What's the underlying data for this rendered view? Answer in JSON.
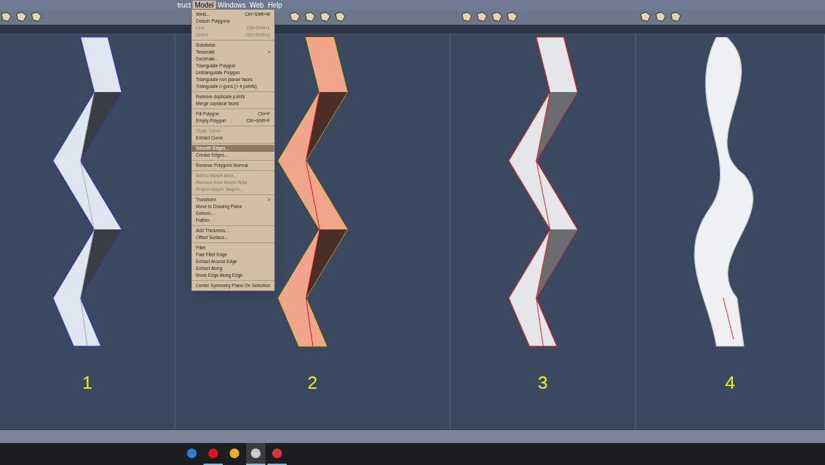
{
  "menubar": [
    {
      "label": "truct",
      "selected": false
    },
    {
      "label": "Model",
      "selected": true
    },
    {
      "label": "Windows",
      "selected": false
    },
    {
      "label": "Web",
      "selected": false
    },
    {
      "label": "Help",
      "selected": false
    }
  ],
  "menu": [
    {
      "kind": "item",
      "label": "Weld...",
      "shortcut": "Ctrl+Shift+W",
      "disabled": false,
      "selected": false
    },
    {
      "kind": "item",
      "label": "Detach Polygons",
      "disabled": false,
      "selected": false
    },
    {
      "kind": "item",
      "label": "Link",
      "shortcut": "Ctrl+Shift+L",
      "disabled": true,
      "selected": false
    },
    {
      "kind": "item",
      "label": "Unlink",
      "shortcut": "Ctrl+Shift+U",
      "disabled": true,
      "selected": false
    },
    {
      "kind": "separator"
    },
    {
      "kind": "item",
      "label": "Subdivide",
      "disabled": false,
      "selected": false
    },
    {
      "kind": "submenu",
      "label": "Tesselate",
      "arrow": ">",
      "disabled": false,
      "selected": false
    },
    {
      "kind": "item",
      "label": "Decimate...",
      "disabled": false,
      "selected": false
    },
    {
      "kind": "item",
      "label": "Triangulate Polygon",
      "disabled": false,
      "selected": false
    },
    {
      "kind": "item",
      "label": "Untriangulate Polygon",
      "disabled": false,
      "selected": false
    },
    {
      "kind": "item",
      "label": "Triangulate non planar faces",
      "disabled": false,
      "selected": false
    },
    {
      "kind": "item",
      "label": "Triangulate n-gons (> 4 points)",
      "disabled": false,
      "selected": false
    },
    {
      "kind": "separator"
    },
    {
      "kind": "item",
      "label": "Remove duplicate points",
      "disabled": false,
      "selected": false
    },
    {
      "kind": "item",
      "label": "Merge coplanar faces",
      "disabled": false,
      "selected": false
    },
    {
      "kind": "separator"
    },
    {
      "kind": "item",
      "label": "Fill Polygon",
      "shortcut": "Ctrl+F",
      "disabled": false,
      "selected": false
    },
    {
      "kind": "item",
      "label": "Empty Polygon",
      "shortcut": "Ctrl+Shift+F",
      "disabled": false,
      "selected": false
    },
    {
      "kind": "separator"
    },
    {
      "kind": "item",
      "label": "Close Curve",
      "disabled": true,
      "selected": false
    },
    {
      "kind": "item",
      "label": "Extract Curve",
      "disabled": false,
      "selected": false
    },
    {
      "kind": "separator"
    },
    {
      "kind": "item",
      "label": "Smooth Edges...",
      "disabled": false,
      "selected": true
    },
    {
      "kind": "item",
      "label": "Crease Edges...",
      "disabled": false,
      "selected": false
    },
    {
      "kind": "separator"
    },
    {
      "kind": "item",
      "label": "Reverse Polygons Normal",
      "disabled": false,
      "selected": false
    },
    {
      "kind": "separator"
    },
    {
      "kind": "item",
      "label": "Add to Morph Area...",
      "disabled": true,
      "selected": false
    },
    {
      "kind": "item",
      "label": "Remove from Morph Area",
      "disabled": true,
      "selected": false
    },
    {
      "kind": "item",
      "label": "Project Morph Targets...",
      "disabled": true,
      "selected": false
    },
    {
      "kind": "separator"
    },
    {
      "kind": "submenu",
      "label": "Transform",
      "arrow": ">",
      "disabled": false,
      "selected": false
    },
    {
      "kind": "item",
      "label": "Move to Drawing Plane",
      "disabled": false,
      "selected": false
    },
    {
      "kind": "item",
      "label": "Deform...",
      "disabled": false,
      "selected": false
    },
    {
      "kind": "item",
      "label": "Flatten",
      "disabled": false,
      "selected": false
    },
    {
      "kind": "separator"
    },
    {
      "kind": "item",
      "label": "Add Thickness...",
      "disabled": false,
      "selected": false
    },
    {
      "kind": "item",
      "label": "Offset Surface...",
      "disabled": false,
      "selected": false
    },
    {
      "kind": "separator"
    },
    {
      "kind": "item",
      "label": "Fillet",
      "disabled": false,
      "selected": false
    },
    {
      "kind": "item",
      "label": "Fast Fillet Edge",
      "disabled": false,
      "selected": false
    },
    {
      "kind": "item",
      "label": "Extract Around Edge",
      "disabled": false,
      "selected": false
    },
    {
      "kind": "item",
      "label": "Extract Along",
      "disabled": false,
      "selected": false
    },
    {
      "kind": "item",
      "label": "Move Edge Along Edge",
      "disabled": false,
      "selected": false
    },
    {
      "kind": "separator"
    },
    {
      "kind": "item",
      "label": "Center Symmetry Plane On Selection",
      "disabled": false,
      "selected": false
    }
  ],
  "viewports": [
    {
      "number": "1",
      "kind": "faceted"
    },
    {
      "number": "2",
      "kind": "selected"
    },
    {
      "number": "3",
      "kind": "edges"
    },
    {
      "number": "4",
      "kind": "smooth"
    }
  ],
  "taskbar": [
    {
      "running": false,
      "selected": false
    },
    {
      "running": true,
      "selected": false
    },
    {
      "running": false,
      "selected": false
    },
    {
      "running": true,
      "selected": true
    },
    {
      "running": true,
      "selected": false
    }
  ]
}
